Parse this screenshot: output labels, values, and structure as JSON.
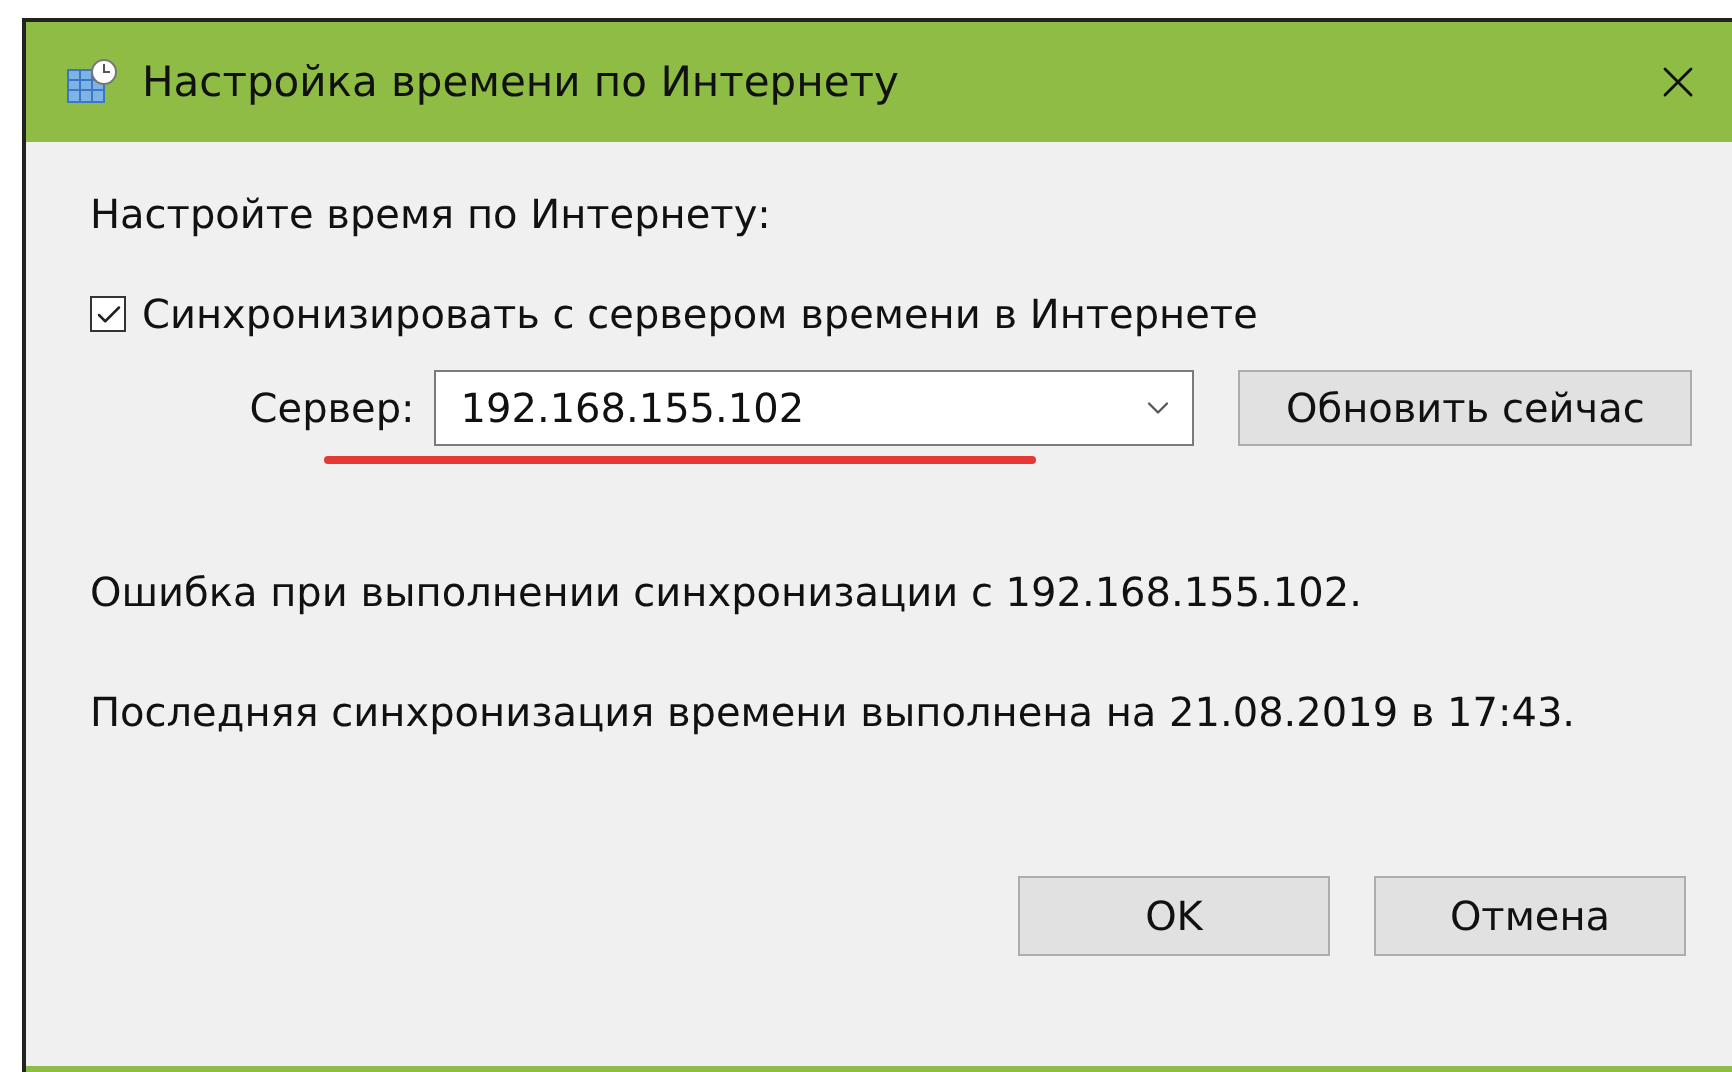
{
  "window": {
    "title": "Настройка времени по Интернету"
  },
  "prompt": "Настройте время по Интернету:",
  "sync": {
    "label": "Синхронизировать с сервером времени в Интернете",
    "checked": true
  },
  "server": {
    "label": "Сервер:",
    "value": "192.168.155.102"
  },
  "update_button": "Обновить сейчас",
  "messages": [
    "Ошибка при выполнении синхронизации с 192.168.155.102.",
    "Последняя синхронизация времени выполнена на 21.08.2019 в 17:43."
  ],
  "buttons": [
    "OK",
    "Отмена"
  ]
}
